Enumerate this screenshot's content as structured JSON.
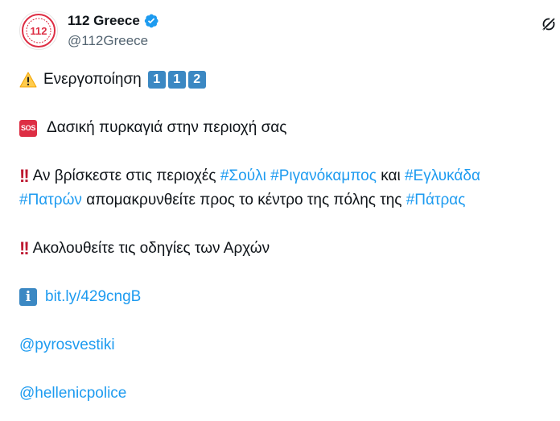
{
  "author": {
    "display_name": "112 Greece",
    "handle": "@112Greece",
    "avatar_text": "112"
  },
  "colors": {
    "link": "#1d9bf0",
    "verified": "#1d9bf0",
    "keycap": "#3b88c3",
    "sos": "#dd2e44",
    "double_exclamation": "#be1931",
    "warning": "#ffcc4d"
  },
  "icons": [
    "verified-badge-icon",
    "grok-icon",
    "warning-icon",
    "keycap-1-icon",
    "keycap-2-icon",
    "sos-icon",
    "double-exclamation-icon",
    "info-icon"
  ],
  "tweet": {
    "line1": {
      "text": "Ενεργοποίηση",
      "keycaps": [
        "1",
        "1",
        "2"
      ]
    },
    "line2": {
      "sos_label": "SOS",
      "text": "Δασική πυρκαγιά στην περιοχή σας"
    },
    "line3": {
      "text_a": "Αν βρίσκεστε στις περιοχές",
      "tag1": "#Σούλι",
      "tag2": "#Ριγανόκαμπος",
      "text_b": "και",
      "tag3": "#Εγλυκάδα"
    },
    "line4": {
      "tag4": "#Πατρών",
      "text_c": "απομακρυνθείτε προς το κέντρο της πόλης της",
      "tag5": "#Πάτρας"
    },
    "line5": {
      "text": "Ακολουθείτε τις οδηγίες των Αρχών"
    },
    "line6": {
      "info_label": "i",
      "link": "bit.ly/429cngB"
    },
    "mention1": "@pyrosvestiki",
    "mention2": "@hellenicpolice"
  }
}
